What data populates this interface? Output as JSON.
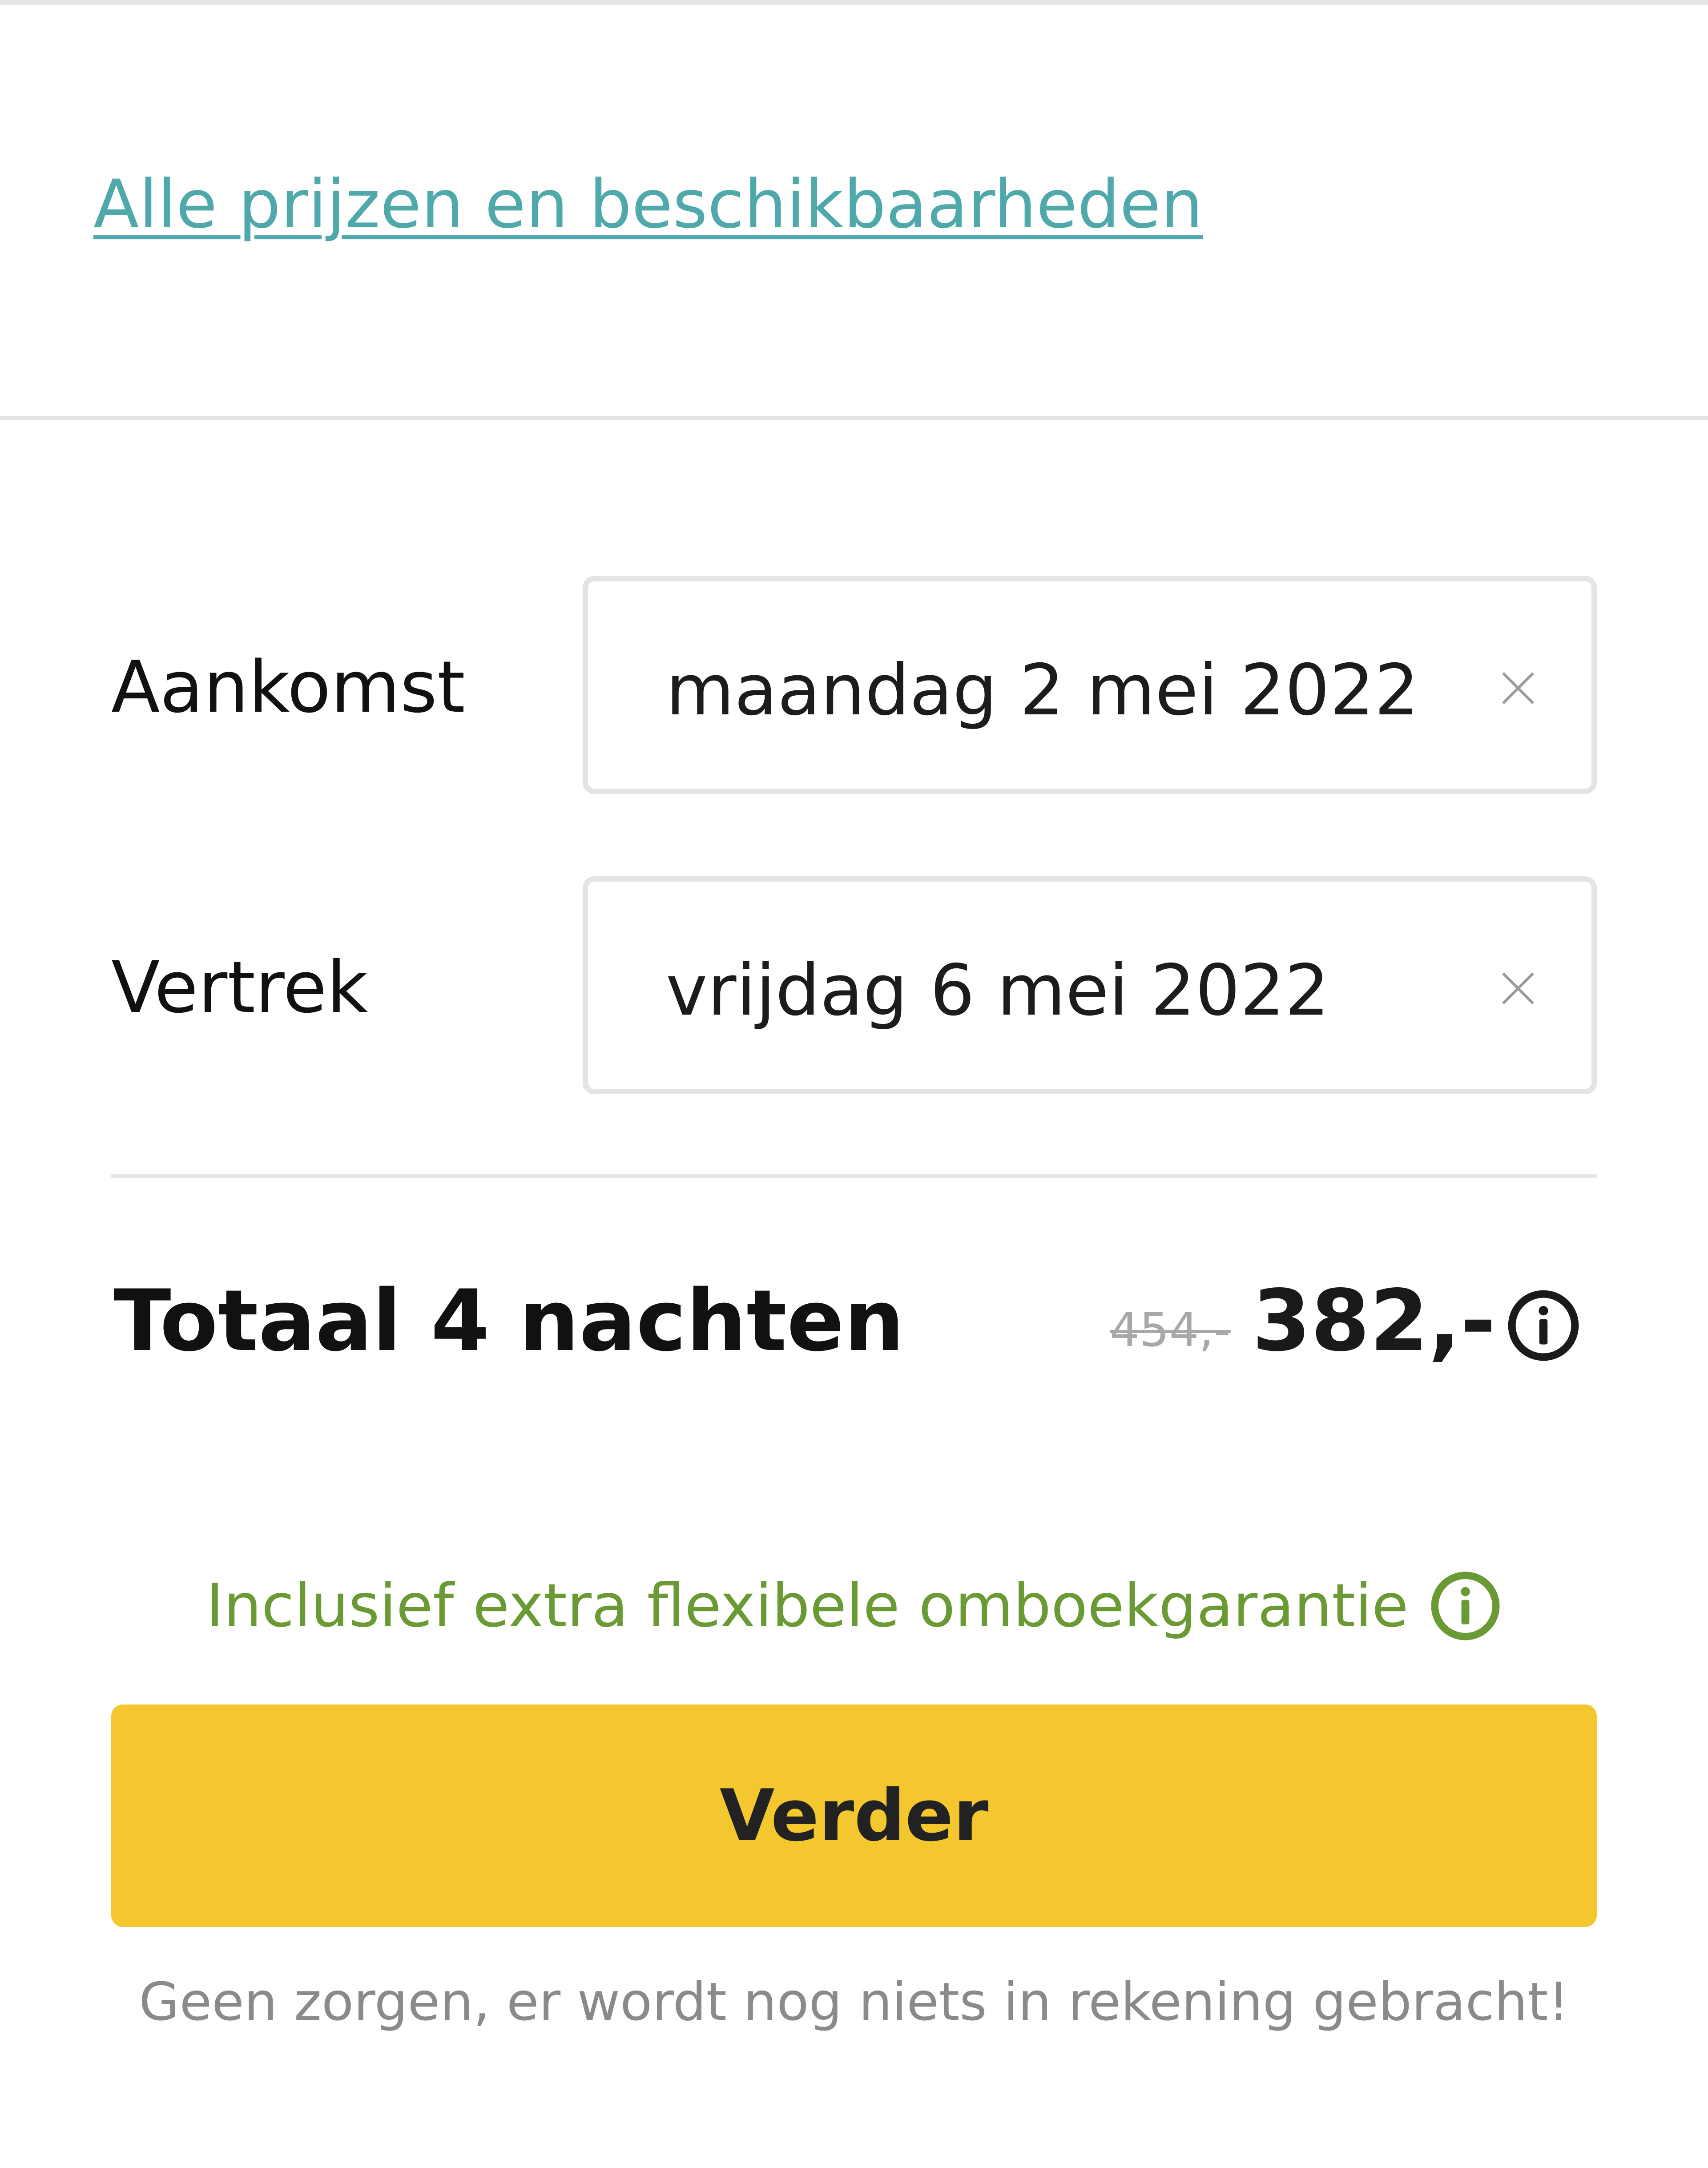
{
  "links": {
    "all_prices": "Alle prijzen en beschikbaarheden"
  },
  "booking": {
    "arrival": {
      "label": "Aankomst",
      "value": "maandag 2 mei 2022",
      "clear_icon": "close-icon"
    },
    "departure": {
      "label": "Vertrek",
      "value": "vrijdag 6 mei 2022",
      "clear_icon": "close-icon"
    }
  },
  "price": {
    "total_label": "Totaal 4 nachten",
    "old_price": "454,-",
    "new_price": "382,-",
    "info_icon": "info-icon"
  },
  "guarantee": {
    "text": "Inclusief extra flexibele omboekgarantie",
    "info_icon": "info-icon"
  },
  "actions": {
    "continue_label": "Verder"
  },
  "footer": {
    "reassurance": "Geen zorgen, er wordt nog niets in rekening gebracht!"
  },
  "colors": {
    "link": "#4fa8aa",
    "guarantee": "#6a9a34",
    "button": "#f3c72d",
    "muted_text": "#8a8a8a"
  }
}
